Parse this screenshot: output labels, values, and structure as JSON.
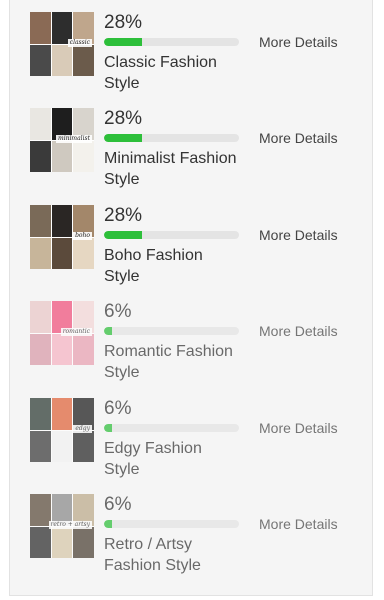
{
  "results": [
    {
      "percent_label": "28%",
      "percent": 28,
      "name": "Classic Fashion Style",
      "details_label": "More Details",
      "thumbnail_caption": "classic",
      "colors": {
        "bar_fill": "#2dbf3a",
        "thumb": [
          "#8a6a55",
          "#2d2d2d",
          "#bfa68c",
          "#4a4a4a",
          "#d9cbb8",
          "#6b5b4b"
        ]
      }
    },
    {
      "percent_label": "28%",
      "percent": 28,
      "name": "Minimalist Fashion Style",
      "details_label": "More Details",
      "thumbnail_caption": "minimalist",
      "colors": {
        "bar_fill": "#2dbf3a",
        "thumb": [
          "#e9e7e2",
          "#1e1e1e",
          "#d8d4cd",
          "#3a3a3a",
          "#cfc9c0",
          "#f3f1ec"
        ]
      }
    },
    {
      "percent_label": "28%",
      "percent": 28,
      "name": "Boho Fashion Style",
      "details_label": "More Details",
      "thumbnail_caption": "boho",
      "colors": {
        "bar_fill": "#2dbf3a",
        "thumb": [
          "#7a6a58",
          "#2a2624",
          "#a3876a",
          "#c7b59a",
          "#5b4a3b",
          "#e6d7c2"
        ]
      }
    },
    {
      "percent_label": "6%",
      "percent": 6,
      "name": "Romantic Fashion Style",
      "details_label": "More Details",
      "thumbnail_caption": "romantic",
      "colors": {
        "bar_fill": "#2dbf3a",
        "thumb": [
          "#e9c7c6",
          "#f04f7a",
          "#f3d6d6",
          "#d99aa8",
          "#f6b3c2",
          "#e8a0b0"
        ]
      }
    },
    {
      "percent_label": "6%",
      "percent": 6,
      "name": "Edgy Fashion Style",
      "details_label": "More Details",
      "thumbnail_caption": "edgy",
      "colors": {
        "bar_fill": "#2dbf3a",
        "thumb": [
          "#2c3a33",
          "#e0633a",
          "#1b1b1b",
          "#3a3a3a",
          "#f2f2f2",
          "#262626"
        ]
      }
    },
    {
      "percent_label": "6%",
      "percent": 6,
      "name": "Retro / Artsy Fashion Style",
      "details_label": "More Details",
      "thumbnail_caption": "retro + artsy",
      "colors": {
        "bar_fill": "#2dbf3a",
        "thumb": [
          "#5a4a3a",
          "#8a8a8a",
          "#bca98a",
          "#2b2b2b",
          "#d6c7a8",
          "#4a3f33"
        ]
      }
    }
  ]
}
